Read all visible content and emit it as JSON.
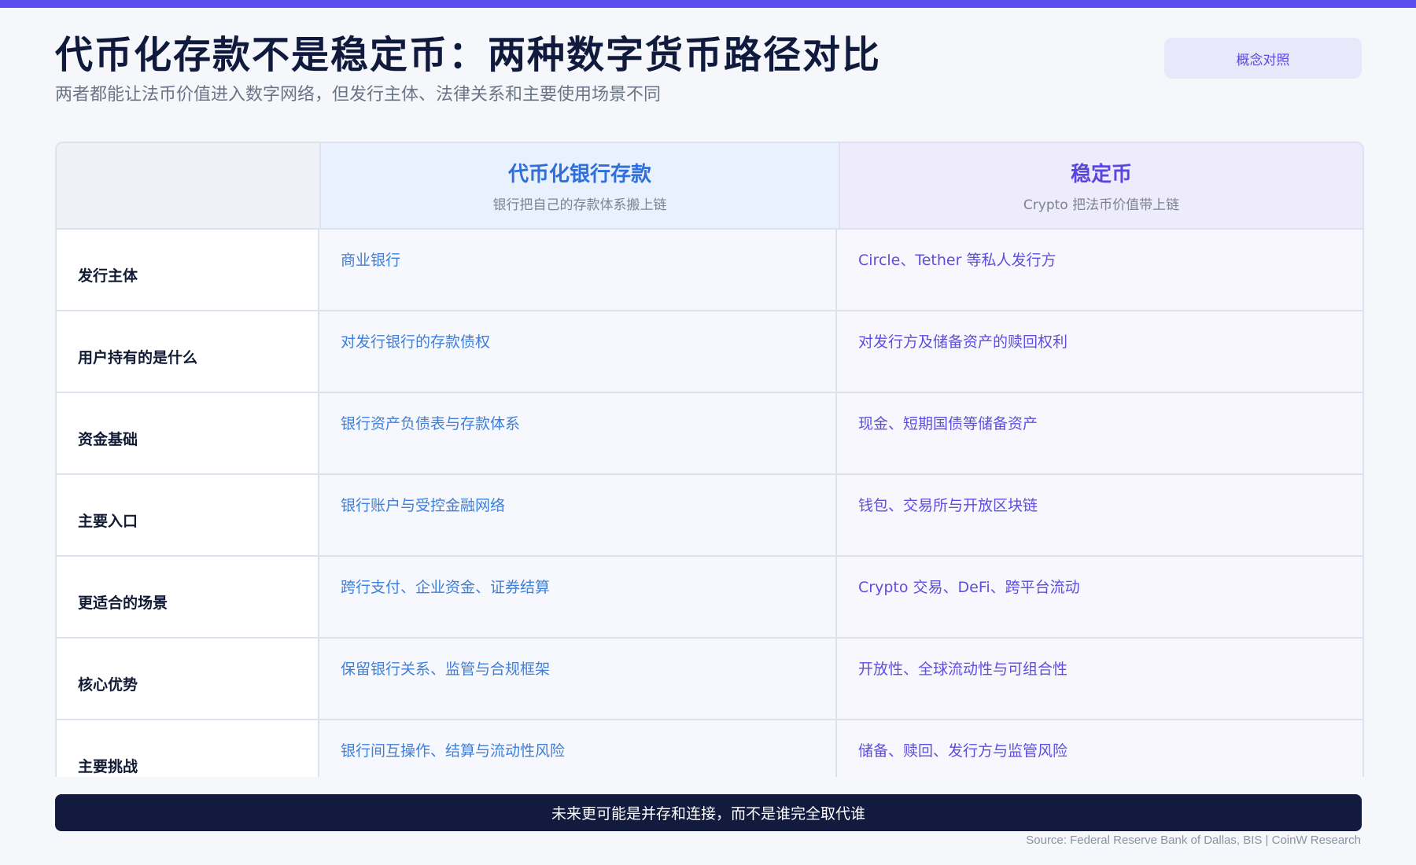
{
  "header": {
    "title": "代币化存款不是稳定币：两种数字货币路径对比",
    "subtitle": "两者都能让法币价值进入数字网络，但发行主体、法律关系和主要使用场景不同",
    "badge": "概念对照"
  },
  "columns": [
    {
      "title": "代币化银行存款",
      "subtitle": "银行把自己的存款体系搬上链"
    },
    {
      "title": "稳定币",
      "subtitle": "Crypto 把法币价值带上链"
    }
  ],
  "rows": [
    {
      "label": "发行主体",
      "a": "商业银行",
      "b": "Circle、Tether 等私人发行方"
    },
    {
      "label": "用户持有的是什么",
      "a": "对发行银行的存款债权",
      "b": "对发行方及储备资产的赎回权利"
    },
    {
      "label": "资金基础",
      "a": "银行资产负债表与存款体系",
      "b": "现金、短期国债等储备资产"
    },
    {
      "label": "主要入口",
      "a": "银行账户与受控金融网络",
      "b": "钱包、交易所与开放区块链"
    },
    {
      "label": "更适合的场景",
      "a": "跨行支付、企业资金、证券结算",
      "b": "Crypto 交易、DeFi、跨平台流动"
    },
    {
      "label": "核心优势",
      "a": "保留银行关系、监管与合规框架",
      "b": "开放性、全球流动性与可组合性"
    },
    {
      "label": "主要挑战",
      "a": "银行间互操作、结算与流动性风险",
      "b": "储备、赎回、发行方与监管风险"
    }
  ],
  "footer": {
    "conclusion": "未来更可能是并存和连接，而不是谁完全取代谁",
    "source": "Source: Federal Reserve Bank of Dallas, BIS | CoinW Research"
  },
  "colors": {
    "accent": "#5b4cf0",
    "bank_blue": "#3d7fd9",
    "stable_purple": "#5e4ee0",
    "footer_bg": "#121a3e"
  }
}
